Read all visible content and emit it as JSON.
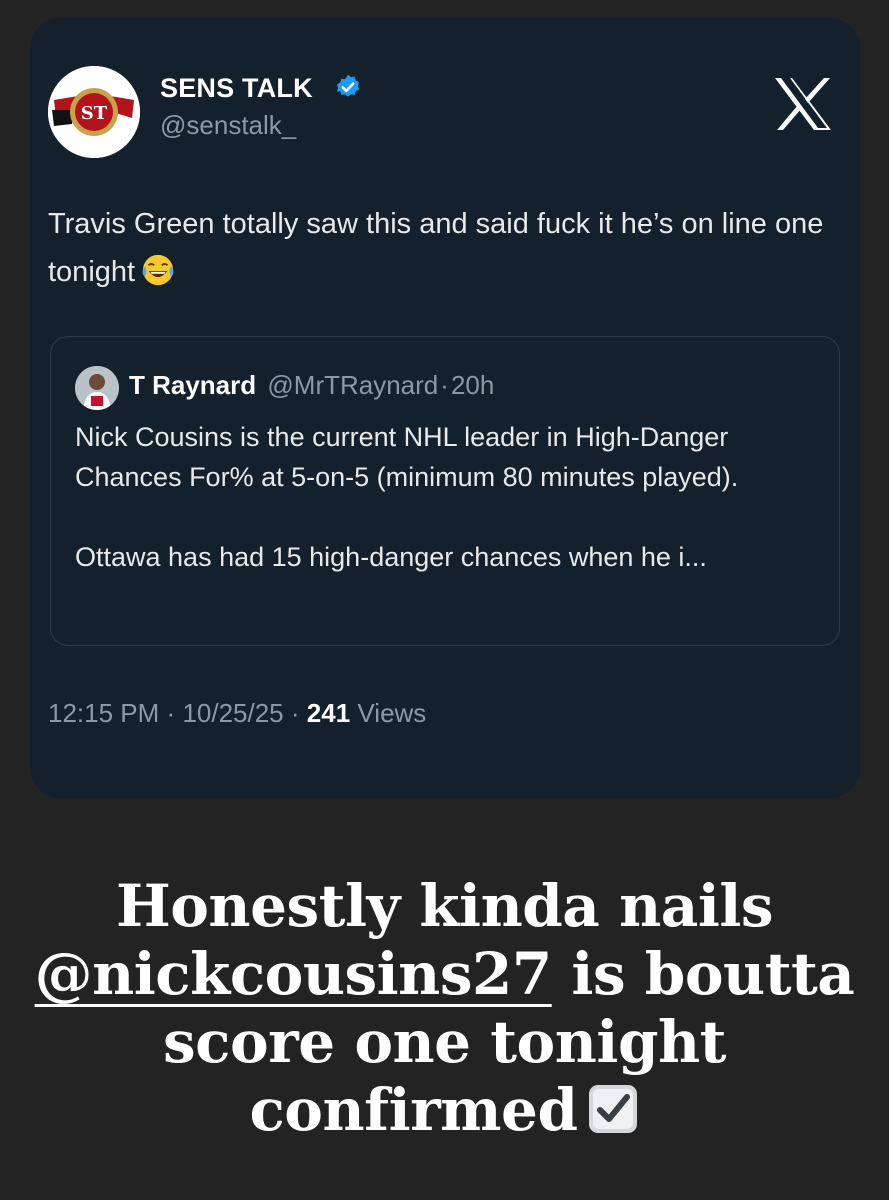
{
  "tweet": {
    "author_name": "SENS TALK",
    "author_handle": "@senstalk_",
    "avatar_initials": "ST",
    "text": "Travis Green totally saw this and said fuck it he’s on line one tonight",
    "emoji": "face-with-tears-of-joy",
    "quoted": {
      "name": "T Raynard",
      "handle": "@MrTRaynard",
      "separator": "·",
      "age": "20h",
      "paragraph1": "Nick Cousins is the current NHL leader in High-Danger Chances For% at 5-on-5 (minimum 80 minutes played).",
      "paragraph2": "Ottawa has had 15 high-danger chances when he i..."
    },
    "time": "12:15 PM",
    "separator": "·",
    "date": "10/25/25",
    "views_count": "241",
    "views_label": "Views"
  },
  "caption": {
    "line1": "Honestly kinda nails",
    "mention": "@nickcousins27",
    "line2_rest": " is boutta",
    "line3": "score one tonight",
    "line4": "confirmed"
  },
  "colors": {
    "background": "#232323",
    "card": "#15202d",
    "verified": "#1d9bf0",
    "muted_text": "#8b98a5"
  },
  "icons": [
    "verified-badge-icon",
    "x-logo-icon",
    "laughing-emoji-icon",
    "check-box-emoji-icon"
  ]
}
